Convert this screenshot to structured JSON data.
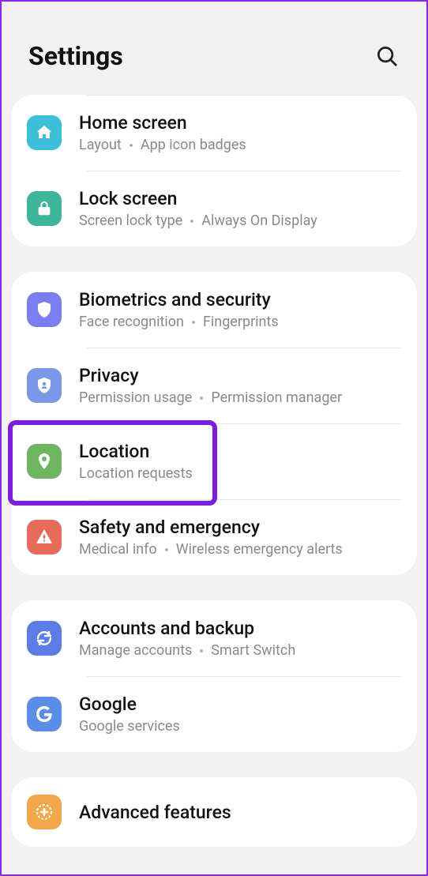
{
  "header": {
    "title": "Settings"
  },
  "groups": [
    {
      "items": [
        {
          "id": "home-screen",
          "title": "Home screen",
          "sub": [
            "Layout",
            "App icon badges"
          ],
          "color": "#3dbfd9",
          "icon": "home"
        },
        {
          "id": "lock-screen",
          "title": "Lock screen",
          "sub": [
            "Screen lock type",
            "Always On Display"
          ],
          "color": "#3db59a",
          "icon": "lock"
        }
      ]
    },
    {
      "items": [
        {
          "id": "biometrics",
          "title": "Biometrics and security",
          "sub": [
            "Face recognition",
            "Fingerprints"
          ],
          "color": "#7a7ef2",
          "icon": "shield"
        },
        {
          "id": "privacy",
          "title": "Privacy",
          "sub": [
            "Permission usage",
            "Permission manager"
          ],
          "color": "#7a97e8",
          "icon": "privacy"
        },
        {
          "id": "location",
          "title": "Location",
          "sub": [
            "Location requests"
          ],
          "color": "#6fb55f",
          "icon": "pin",
          "highlight": true
        },
        {
          "id": "safety",
          "title": "Safety and emergency",
          "sub": [
            "Medical info",
            "Wireless emergency alerts"
          ],
          "color": "#e86a5a",
          "icon": "alert"
        }
      ]
    },
    {
      "items": [
        {
          "id": "accounts",
          "title": "Accounts and backup",
          "sub": [
            "Manage accounts",
            "Smart Switch"
          ],
          "color": "#5a7de6",
          "icon": "sync"
        },
        {
          "id": "google",
          "title": "Google",
          "sub": [
            "Google services"
          ],
          "color": "#5a8de6",
          "icon": "google"
        }
      ]
    },
    {
      "items": [
        {
          "id": "advanced",
          "title": "Advanced features",
          "sub": [],
          "color": "#f2a84a",
          "icon": "plus"
        }
      ]
    }
  ]
}
